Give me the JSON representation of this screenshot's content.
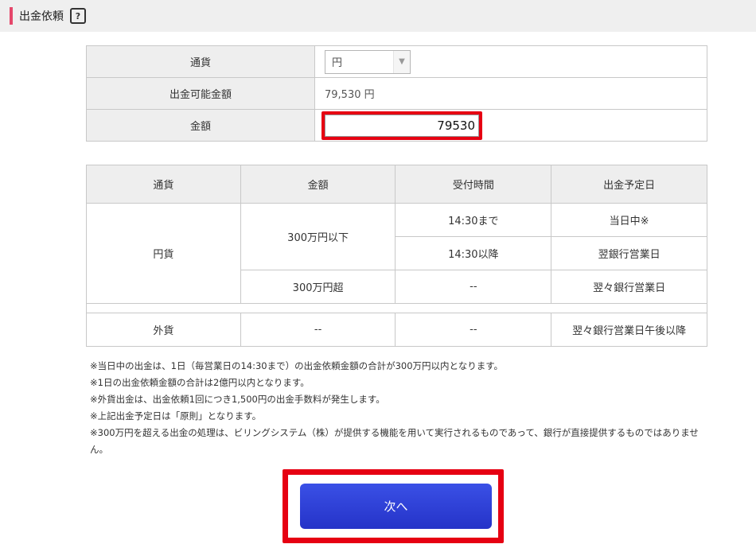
{
  "header": {
    "title": "出金依頼",
    "help_icon": "?"
  },
  "form": {
    "currency_label": "通貨",
    "currency_value": "円",
    "available_label": "出金可能金額",
    "available_value": "79,530 円",
    "amount_label": "金額",
    "amount_value": "79530"
  },
  "schedule": {
    "headers": [
      "通貨",
      "金額",
      "受付時間",
      "出金予定日"
    ],
    "yen_label": "円貨",
    "under_amount": "300万円以下",
    "over_amount": "300万円超",
    "time_before": "14:30まで",
    "time_after": "14:30以降",
    "date_same_day": "当日中※",
    "date_next": "翌銀行営業日",
    "dash": "--",
    "date_next_next": "翌々銀行営業日",
    "foreign_label": "外貨",
    "date_foreign": "翌々銀行営業日午後以降"
  },
  "notes": [
    "※当日中の出金は、1日（毎営業日の14:30まで）の出金依頼金額の合計が300万円以内となります。",
    "※1日の出金依頼金額の合計は2億円以内となります。",
    "※外貨出金は、出金依頼1回につき1,500円の出金手数料が発生します。",
    "※上記出金予定日は「原則」となります。",
    "※300万円を超える出金の処理は、ビリングシステム（株）が提供する機能を用いて実行されるものであって、銀行が直接提供するものではありません。"
  ],
  "next_button": "次へ",
  "colors": {
    "accent": "#e5476b",
    "highlight": "#e60012",
    "button": "#2f42d9"
  }
}
